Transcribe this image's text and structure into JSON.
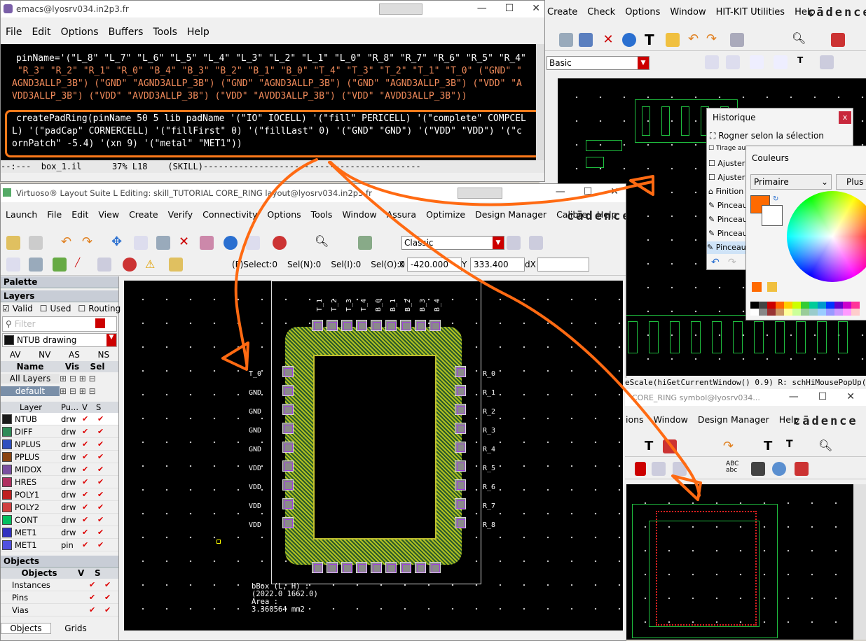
{
  "emacs": {
    "title": "emacs@lyosrv034.in2p3.fr",
    "menu": [
      "File",
      "Edit",
      "Options",
      "Buffers",
      "Tools",
      "Help"
    ],
    "code_lines": [
      "pinName='(\"L_8\" \"L_7\" \"L_6\" \"L_5\" \"L_4\" \"L_3\" \"L_2\" \"L_1\" \"L_0\" \"R_8\" \"R_7\" \"R_6\" \"R_5\" \"R_4\"",
      " \"R_3\" \"R_2\" \"R_1\" \"R_0\" \"B_4\" \"B_3\" \"B_2\" \"B_1\" \"B_0\" \"T_4\" \"T_3\" \"T_2\" \"T_1\" \"T_0\" (\"GND\" \"",
      "AGND3ALLP_3B\") (\"GND\" \"AGND3ALLP_3B\") (\"GND\" \"AGND3ALLP_3B\") (\"GND\" \"AGND3ALLP_3B\") (\"VDD\" \"A",
      "VDD3ALLP_3B\") (\"VDD\" \"AVDD3ALLP_3B\") (\"VDD\" \"AVDD3ALLP_3B\") (\"VDD\" \"AVDD3ALLP_3B\"))",
      "",
      "createPadRing(pinName 50 5 lib padName '(\"IO\" IOCELL) '(\"fill\" PERICELL) '(\"complete\" COMPCEL",
      "L) '(\"padCap\" CORNERCELL) '(\"fillFirst\" 0) '(\"fillLast\" 0) '(\"GND\" \"GND\") '(\"VDD\" \"VDD\") '(\"c",
      "ornPatch\" -5.4) '(xn 9) '(\"metal\" \"MET1\"))"
    ],
    "modeline": "--:---  box_1.il      37% L18    (SKILL)-------------------------------------------"
  },
  "schematic_bg": {
    "menu": [
      "Create",
      "Check",
      "Options",
      "Window",
      "HIT-KIT Utilities",
      "Help"
    ],
    "brand": "cādence",
    "combo": "Basic"
  },
  "historique": {
    "title": "Historique",
    "items": [
      "Rogner selon la sélection",
      "Tirage au",
      "Ajuster",
      "Ajuster",
      "Finition",
      "Pinceau",
      "Pinceau",
      "Pinceau",
      "Pinceau"
    ]
  },
  "couleurs": {
    "title": "Couleurs",
    "mode": "Primaire",
    "plus": "Plus",
    "accent": "#ff6a00"
  },
  "layout": {
    "title": "Virtuoso® Layout Suite L Editing: skill_TUTORIAL CORE_RING layout@lyosrv034.in2p3.fr",
    "menu": [
      "Launch",
      "File",
      "Edit",
      "View",
      "Create",
      "Verify",
      "Connectivity",
      "Options",
      "Tools",
      "Window",
      "Assura",
      "Optimize",
      "Design Manager",
      "Calibre",
      "Help"
    ],
    "brand": "cādence",
    "combo": "Classic",
    "status": {
      "select": "(F)Select:0",
      "seln": "Sel(N):0",
      "seli": "Sel(I):0",
      "selo": "Sel(O):0",
      "x_label": "X",
      "x": "-420.000",
      "y_label": "Y",
      "y": "333.400",
      "dx_label": "dX"
    },
    "palette": {
      "title": "Palette",
      "layers_title": "Layers",
      "valid": "Valid",
      "used": "Used",
      "routing": "Routing",
      "filter": "Filter",
      "current_layer": "NTUB drawing",
      "cols": [
        "AV",
        "NV",
        "AS",
        "NS"
      ],
      "name_hdr": "Name",
      "vis_hdr": "Vis",
      "sel_hdr": "Sel",
      "all_layers": "All Layers",
      "default": "default",
      "table_hdr": [
        "Layer",
        "Pu...",
        "V",
        "S"
      ],
      "layers": [
        {
          "name": "NTUB",
          "p": "drw",
          "color": "#1a1a1a"
        },
        {
          "name": "DIFF",
          "p": "drw",
          "color": "#2e8b57"
        },
        {
          "name": "NPLUS",
          "p": "drw",
          "color": "#2f4fbf"
        },
        {
          "name": "PPLUS",
          "p": "drw",
          "color": "#8b4513"
        },
        {
          "name": "MIDOX",
          "p": "drw",
          "color": "#7a4fa0"
        },
        {
          "name": "HRES",
          "p": "drw",
          "color": "#b03060"
        },
        {
          "name": "POLY1",
          "p": "drw",
          "color": "#c02020"
        },
        {
          "name": "POLY2",
          "p": "drw",
          "color": "#d04040"
        },
        {
          "name": "CONT",
          "p": "drw",
          "color": "#00c060"
        },
        {
          "name": "MET1",
          "p": "drw",
          "color": "#3030c0"
        },
        {
          "name": "MET1",
          "p": "pin",
          "color": "#5050e0"
        }
      ],
      "objects_title": "Objects",
      "objects_hdr": "Objects",
      "objects": [
        "Instances",
        "Pins",
        "Vias"
      ],
      "tabs": [
        "Objects",
        "Grids"
      ]
    },
    "left_pins": [
      "T_0",
      "GND",
      "GND",
      "GND",
      "GND",
      "VDD",
      "VDD",
      "VDD",
      "VDD"
    ],
    "right_pins": [
      "R_0",
      "R_1",
      "R_2",
      "R_3",
      "R_4",
      "R_5",
      "R_6",
      "R_7",
      "R_8"
    ],
    "top_pins": [
      "T_1",
      "T_2",
      "T_3",
      "T_4",
      "B_0",
      "B_1",
      "B_2",
      "B_3",
      "B_4"
    ],
    "bbox_text": [
      "bBox (L, H) :",
      "(2022.0 1662.0)",
      "Area :",
      "3.360564 mm2"
    ]
  },
  "symbol_win": {
    "cmd": "eScale(hiGetCurrentWindow() 0.9)    R: schHiMousePopUp()",
    "title": "CORE_RING symbol@lyosrv034...",
    "menu": [
      "ions",
      "Window",
      "Design Manager",
      "Help"
    ],
    "brand": "cādence"
  }
}
